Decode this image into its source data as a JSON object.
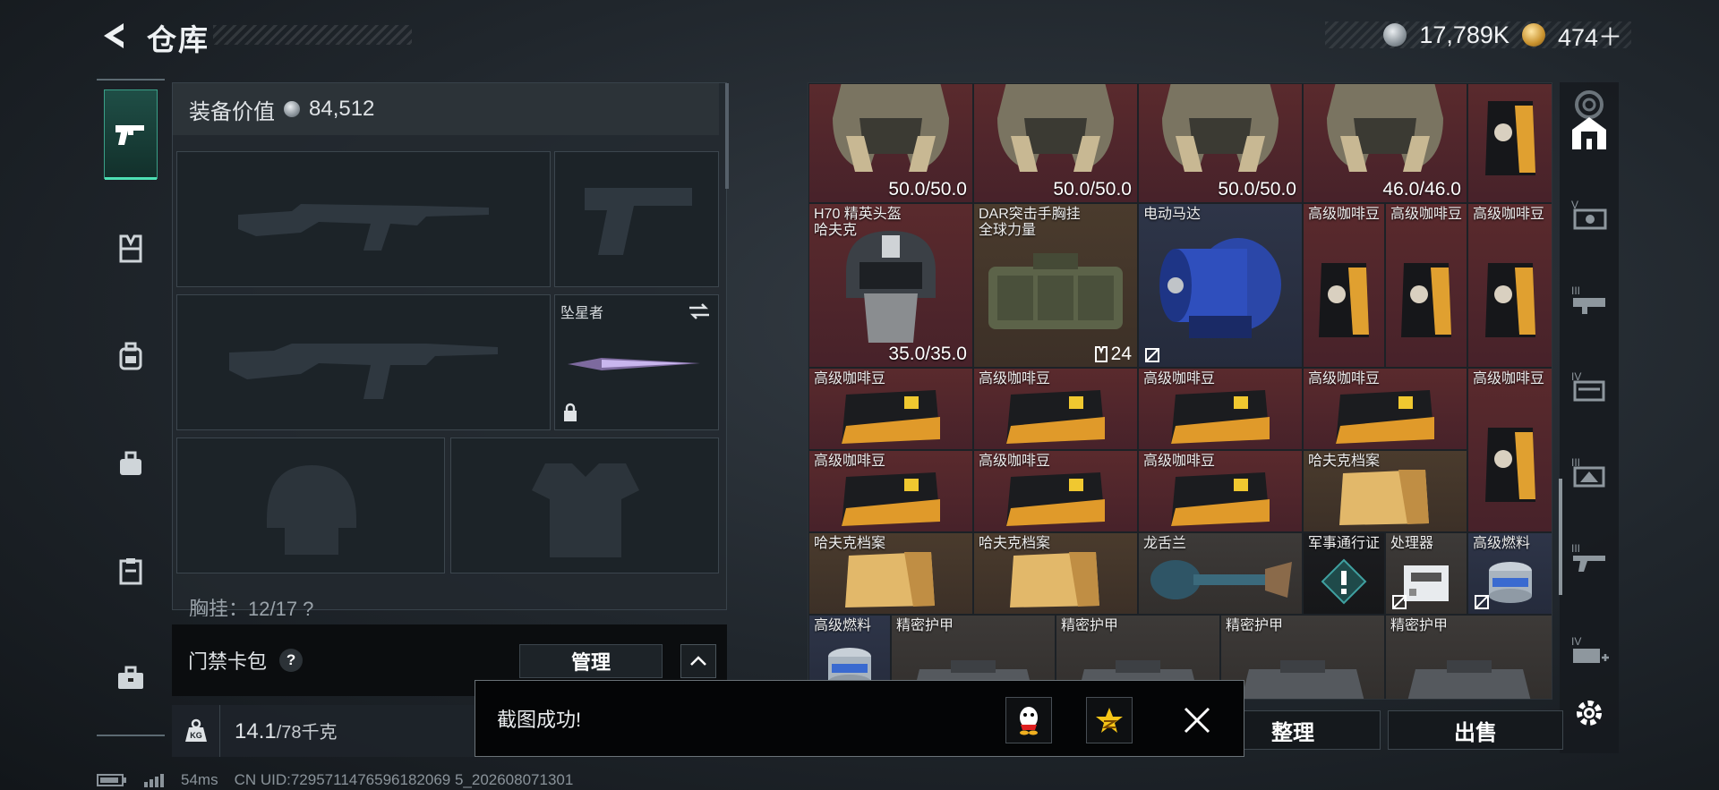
{
  "header": {
    "title": "仓库",
    "currency": [
      {
        "icon": "silver-coin-icon",
        "value": "17,789K"
      },
      {
        "icon": "gold-coin-icon",
        "value": "474＋"
      }
    ]
  },
  "left_tabs": [
    "pistol-icon",
    "vest-icon",
    "backpack-icon",
    "bag-icon",
    "clipboard-icon",
    "briefcase-icon"
  ],
  "equipment": {
    "value_label": "装备价值",
    "value": "84,512",
    "melee_label": "坠星者",
    "chest_label": "胸挂：12/17 ?"
  },
  "keycard": {
    "label": "门禁卡包",
    "help": "?",
    "manage": "管理"
  },
  "weight": {
    "current": "14.1",
    "max": "/78千克",
    "icon_label": "KG"
  },
  "footer": {
    "ping": "54ms",
    "uid": "CN UID:7295711476596182069 5_202608071301"
  },
  "inventory": {
    "items": [
      {
        "name": "",
        "dur": "50.0/50.0"
      },
      {
        "name": "",
        "dur": "50.0/50.0"
      },
      {
        "name": "",
        "dur": "50.0/50.0"
      },
      {
        "name": "",
        "dur": "46.0/46.0"
      },
      {
        "name": "",
        "dur": ""
      },
      {
        "name": "H70 精英头盔\n哈夫克",
        "dur": "35.0/35.0"
      },
      {
        "name": "DAR突击手胸挂\n全球力量",
        "qty": "24"
      },
      {
        "name": "电动马达"
      },
      {
        "name": "高级咖啡豆"
      },
      {
        "name": "高级咖啡豆"
      },
      {
        "name": "高级咖啡豆"
      },
      {
        "name": "高级咖啡豆"
      },
      {
        "name": "高级咖啡豆"
      },
      {
        "name": "高级咖啡豆"
      },
      {
        "name": "高级咖啡豆"
      },
      {
        "name": "高级咖啡豆"
      },
      {
        "name": "高级咖啡豆"
      },
      {
        "name": "高级咖啡豆"
      },
      {
        "name": "高级咖啡豆"
      },
      {
        "name": "哈夫克档案"
      },
      {
        "name": "哈夫克档案"
      },
      {
        "name": "哈夫克档案"
      },
      {
        "name": "龙舌兰"
      },
      {
        "name": "军事通行证"
      },
      {
        "name": "处理器"
      },
      {
        "name": "高级燃料"
      },
      {
        "name": "高级燃料"
      },
      {
        "name": "精密护甲"
      },
      {
        "name": "精密护甲"
      },
      {
        "name": "精密护甲"
      },
      {
        "name": "精密护甲"
      }
    ]
  },
  "tools": [
    "ring-icon",
    "home-icon",
    "v-tier-icon",
    "iii-tier-icon",
    "iv-tier-icon",
    "iii-alt-icon",
    "iii-gun-icon",
    "iv-plus-icon"
  ],
  "actions": {
    "sort": "整理",
    "sell": "出售"
  },
  "toast": {
    "text": "截图成功!"
  },
  "colors": {
    "accent": "#4de0b4",
    "item_red": "#5a2a2d",
    "item_gold": "#4a3b2d",
    "item_blue": "#2e3548"
  }
}
